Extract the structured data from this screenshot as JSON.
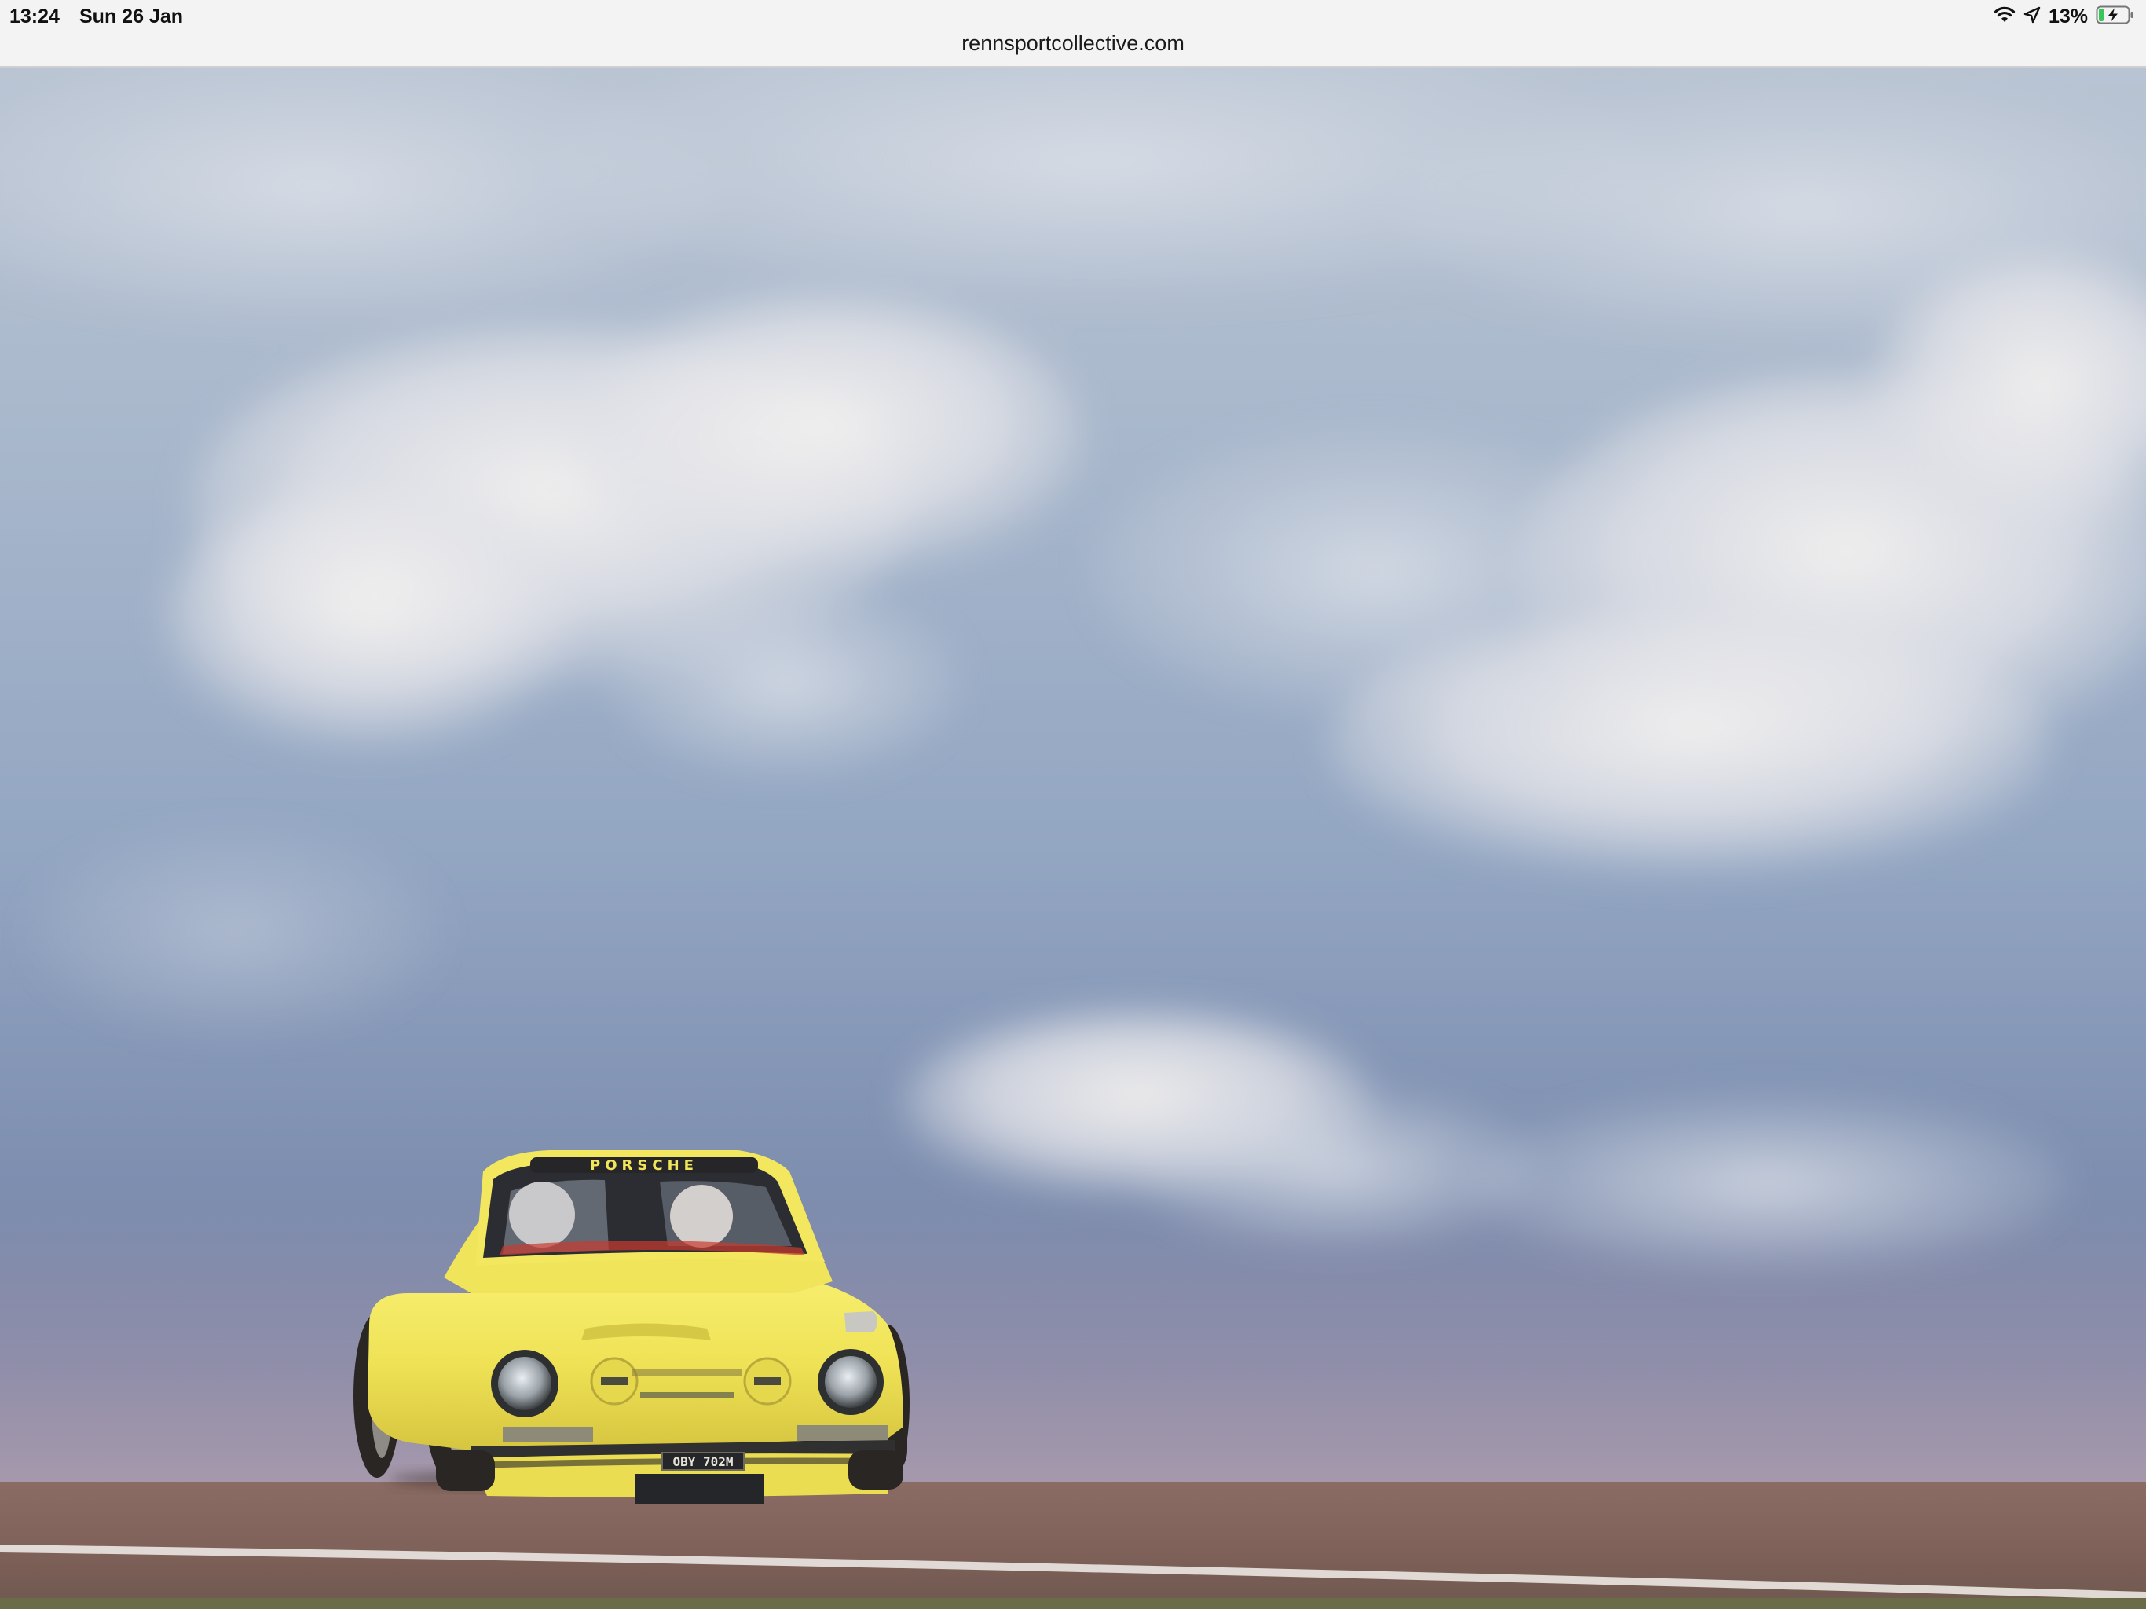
{
  "status_bar": {
    "time": "13:24",
    "date": "Sun 26 Jan",
    "battery_percent": "13%",
    "icons": [
      "wifi-icon",
      "location-arrow-icon",
      "battery-charging-icon"
    ]
  },
  "browser": {
    "url": "rennsportcollective.com"
  },
  "photo": {
    "subject": "yellow racing car on track under cloudy sky",
    "car_windshield_text": "PORSCHE",
    "car_plate_text": "OBY 702M",
    "colors": {
      "car_yellow": "#f2e55a",
      "sky_blue": "#8fa4c2",
      "track_brown": "#8a6a63"
    }
  }
}
